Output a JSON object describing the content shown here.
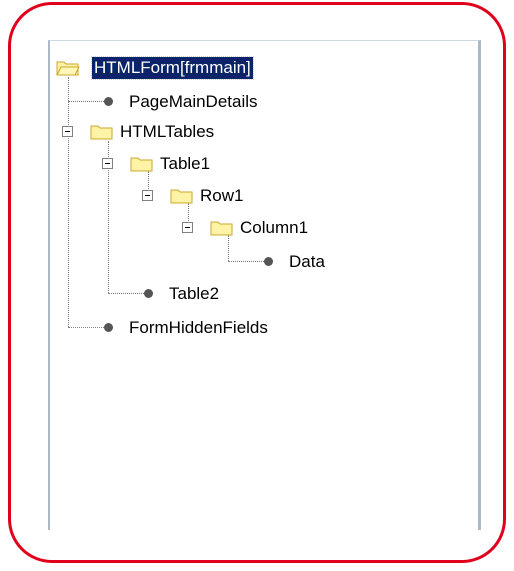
{
  "colors": {
    "annotation_border": "#e0001b",
    "selection_bg": "#0a246a",
    "folder_fill": "#fff3a8",
    "folder_stroke": "#c9a92c"
  },
  "tree": {
    "root": {
      "label": "HTMLForm[frmmain]",
      "icon": "folder-open-icon",
      "selected": true
    },
    "nodes": [
      {
        "label": "PageMainDetails",
        "icon": "bullet-icon"
      },
      {
        "label": "HTMLTables",
        "icon": "folder-icon",
        "expanded": true
      },
      {
        "label": "Table1",
        "icon": "folder-icon",
        "expanded": true
      },
      {
        "label": "Row1",
        "icon": "folder-icon",
        "expanded": true
      },
      {
        "label": "Column1",
        "icon": "folder-icon",
        "expanded": true
      },
      {
        "label": "Data",
        "icon": "bullet-icon"
      },
      {
        "label": "Table2",
        "icon": "bullet-icon"
      },
      {
        "label": "FormHiddenFields",
        "icon": "bullet-icon"
      }
    ]
  }
}
